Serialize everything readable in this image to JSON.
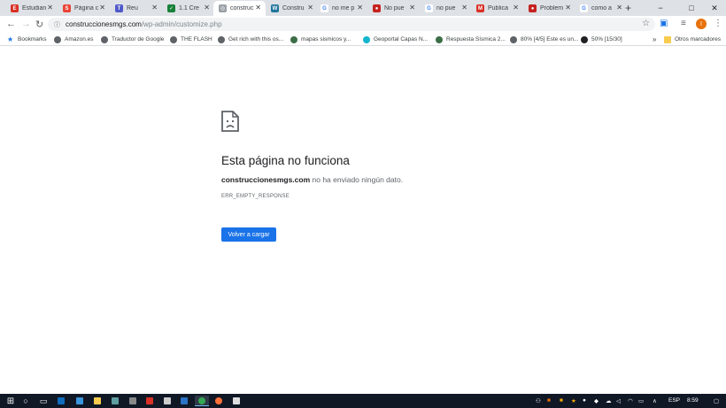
{
  "browser": {
    "tabs": [
      {
        "label": "Estudian",
        "favicon_color": "#d93025",
        "favicon_char": "E"
      },
      {
        "label": "Página c",
        "favicon_color": "#ea4335",
        "favicon_char": "S"
      },
      {
        "label": "Reu",
        "favicon_color": "#5059c9",
        "favicon_char": "T"
      },
      {
        "label": "1.1 Cre",
        "favicon_color": "#188038",
        "favicon_char": "✓"
      },
      {
        "label": "construc",
        "favicon_color": "#9aa0a6",
        "favicon_char": "◎"
      },
      {
        "label": "Constru",
        "favicon_color": "#21759b",
        "favicon_char": "W"
      },
      {
        "label": "no me p",
        "favicon_color": "#ffffff",
        "favicon_char": "G"
      },
      {
        "label": "No pue",
        "favicon_color": "#c5221f",
        "favicon_char": "●"
      },
      {
        "label": "no pue",
        "favicon_color": "#ffffff",
        "favicon_char": "G"
      },
      {
        "label": "Publica",
        "favicon_color": "#d93025",
        "favicon_char": "M"
      },
      {
        "label": "Problem",
        "favicon_color": "#c5221f",
        "favicon_char": "●"
      },
      {
        "label": "como a",
        "favicon_color": "#ffffff",
        "favicon_char": "G"
      }
    ],
    "active_tab_index": 4,
    "new_tab_label": "+",
    "window_controls": {
      "minimize": "−",
      "maximize": "□",
      "close": "✕"
    },
    "address": {
      "host": "construccionesmgs.com",
      "path": "/wp-admin/customize.php"
    },
    "bookmarks": [
      {
        "label": "Bookmarks",
        "icon_color": "#1a73e8"
      },
      {
        "label": "Amazon.es",
        "icon_color": "#5f6368"
      },
      {
        "label": "Traductor de Google",
        "icon_color": "#5f6368"
      },
      {
        "label": "THE FLASH",
        "icon_color": "#5f6368"
      },
      {
        "label": "Get rich with this os...",
        "icon_color": "#5f6368"
      },
      {
        "label": "mapas sismicos y...",
        "icon_color": "#3c6e47"
      },
      {
        "label": "Geoportal Capas N...",
        "icon_color": "#12b5cb"
      },
      {
        "label": "Respuesta Sísmica 2...",
        "icon_color": "#3c6e47"
      },
      {
        "label": "80% [4/5] Este es un...",
        "icon_color": "#5f6368"
      },
      {
        "label": "50% [15/30]",
        "icon_color": "#202124"
      }
    ],
    "bookmarks_overflow": "»",
    "other_bookmarks": "Otros marcadores"
  },
  "error_page": {
    "title": "Esta página no funciona",
    "host": "construccionesmgs.com",
    "message": " no ha enviado ningún dato.",
    "code": "ERR_EMPTY_RESPONSE",
    "reload_button": "Volver a cargar"
  },
  "taskbar": {
    "language": "ESP",
    "time": "8:59"
  }
}
